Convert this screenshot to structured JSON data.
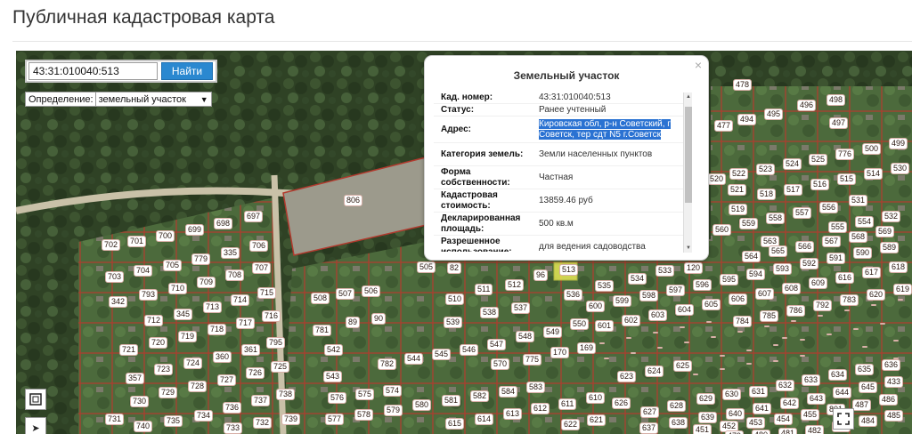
{
  "page": {
    "title": "Публичная кадастровая карта"
  },
  "search": {
    "value": "43:31:010040:513",
    "button_label": "Найти"
  },
  "definition": {
    "label": "Определение:",
    "selected": "земельный участок"
  },
  "popup": {
    "title": "Земельный участок",
    "close": "×",
    "rows": [
      {
        "key": "Кад. номер:",
        "value": "43:31:010040:513"
      },
      {
        "key": "Статус:",
        "value": "Ранее учтенный"
      },
      {
        "key": "Адрес:",
        "value": "Кировская обл, р-н Советский, г Советск, тер сдт N5 г.Советск"
      },
      {
        "key": "Категория земель:",
        "value": "Земли населенных пунктов"
      },
      {
        "key": "Форма собственности:",
        "value": "Частная"
      },
      {
        "key": "Кадастровая стоимость:",
        "value": "13859.46 руб"
      },
      {
        "key": "Декларированная площадь:",
        "value": "500 кв.м"
      },
      {
        "key": "Разрешенное использование:",
        "value": "для ведения садоводства"
      }
    ]
  },
  "map_labels": [
    "806",
    "702",
    "701",
    "700",
    "699",
    "698",
    "697",
    "703",
    "704",
    "705",
    "779",
    "335",
    "706",
    "342",
    "793",
    "710",
    "709",
    "708",
    "707",
    "712",
    "345",
    "713",
    "714",
    "715",
    "721",
    "720",
    "719",
    "718",
    "717",
    "716",
    "723",
    "724",
    "360",
    "361",
    "795",
    "357",
    "729",
    "728",
    "727",
    "726",
    "725",
    "730",
    "736",
    "737",
    "738",
    "739",
    "740",
    "735",
    "734",
    "733",
    "732",
    "731",
    "505",
    "82",
    "96",
    "513",
    "535",
    "534",
    "533",
    "120",
    "508",
    "507",
    "506",
    "510",
    "511",
    "512",
    "536",
    "89",
    "90",
    "539",
    "538",
    "537",
    "781",
    "542",
    "543",
    "544",
    "545",
    "546",
    "547",
    "548",
    "549",
    "550",
    "169",
    "782",
    "570",
    "775",
    "170",
    "576",
    "575",
    "574",
    "584",
    "583",
    "582",
    "581",
    "580",
    "579",
    "578",
    "577",
    "615",
    "614",
    "613",
    "612",
    "611",
    "610",
    "621",
    "622",
    "623",
    "624",
    "625",
    "626",
    "627",
    "628",
    "629",
    "630",
    "631",
    "632",
    "633",
    "634",
    "635",
    "636",
    "637",
    "638",
    "639",
    "640",
    "641",
    "642",
    "643",
    "644",
    "645",
    "433",
    "451",
    "452",
    "453",
    "454",
    "455",
    "801",
    "487",
    "486",
    "485",
    "484",
    "483",
    "482",
    "481",
    "480",
    "479",
    "478",
    "477",
    "494",
    "495",
    "496",
    "497",
    "498",
    "499",
    "500",
    "776",
    "525",
    "524",
    "523",
    "522",
    "521",
    "520",
    "519",
    "518",
    "517",
    "516",
    "515",
    "514",
    "530",
    "531",
    "532",
    "554",
    "555",
    "556",
    "557",
    "558",
    "559",
    "560",
    "561",
    "562",
    "563",
    "564",
    "565",
    "566",
    "567",
    "568",
    "569",
    "589",
    "590",
    "591",
    "592",
    "593",
    "594",
    "595",
    "596",
    "597",
    "598",
    "599",
    "600",
    "601",
    "602",
    "603",
    "604",
    "605",
    "606",
    "607",
    "608",
    "609",
    "616",
    "617",
    "618",
    "619",
    "620",
    "783",
    "792",
    "786",
    "785",
    "784"
  ]
}
